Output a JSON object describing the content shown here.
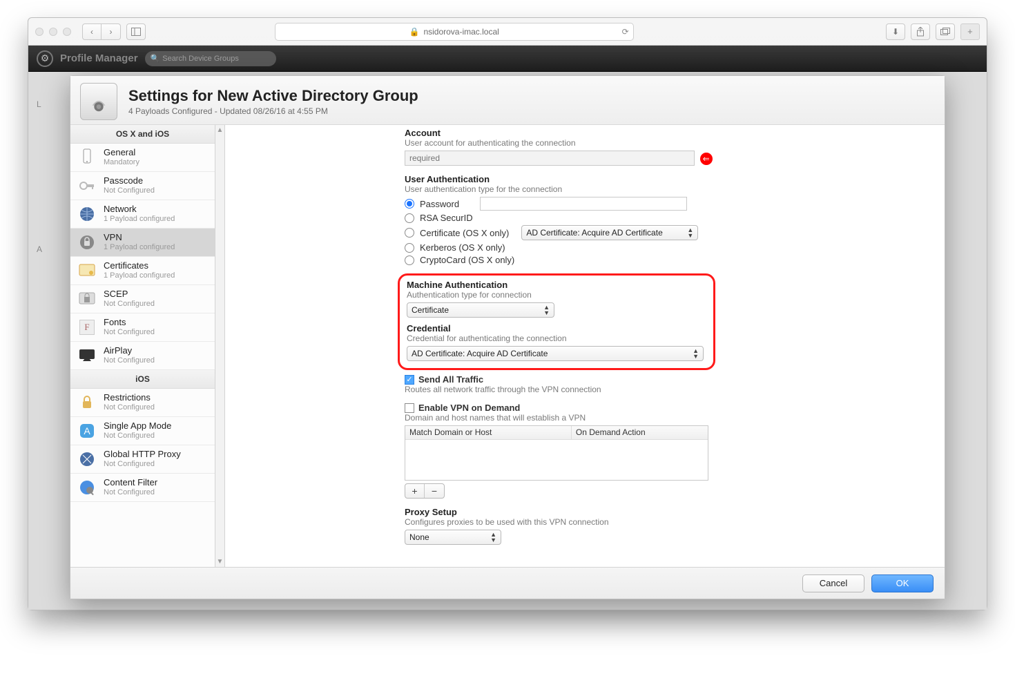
{
  "browser": {
    "address": "nsidorova-imac.local"
  },
  "app": {
    "title": "Profile Manager",
    "search_placeholder": "Search Device Groups"
  },
  "leftPanel": {
    "label_L": "L",
    "label_A": "A"
  },
  "modal": {
    "title": "Settings for New Active Directory Group",
    "subtitle": "4 Payloads Configured - Updated 08/26/16 at 4:55 PM",
    "group1": "OS X and iOS",
    "group2": "iOS",
    "payloads1": [
      {
        "title": "General",
        "status": "Mandatory"
      },
      {
        "title": "Passcode",
        "status": "Not Configured"
      },
      {
        "title": "Network",
        "status": "1 Payload configured"
      },
      {
        "title": "VPN",
        "status": "1 Payload configured"
      },
      {
        "title": "Certificates",
        "status": "1 Payload configured"
      },
      {
        "title": "SCEP",
        "status": "Not Configured"
      },
      {
        "title": "Fonts",
        "status": "Not Configured"
      },
      {
        "title": "AirPlay",
        "status": "Not Configured"
      }
    ],
    "payloads2": [
      {
        "title": "Restrictions",
        "status": "Not Configured"
      },
      {
        "title": "Single App Mode",
        "status": "Not Configured"
      },
      {
        "title": "Global HTTP Proxy",
        "status": "Not Configured"
      },
      {
        "title": "Content Filter",
        "status": "Not Configured"
      }
    ],
    "cancel": "Cancel",
    "ok": "OK"
  },
  "form": {
    "account": {
      "title": "Account",
      "desc": "User account for authenticating the connection",
      "placeholder": "required"
    },
    "user_auth": {
      "title": "User Authentication",
      "desc": "User authentication type for the connection",
      "opt_password": "Password",
      "opt_rsa": "RSA SecurID",
      "opt_cert": "Certificate (OS X only)",
      "opt_kerberos": "Kerberos (OS X only)",
      "opt_crypto": "CryptoCard (OS X only)",
      "cert_select": "AD Certificate: Acquire AD Certificate"
    },
    "machine_auth": {
      "title": "Machine Authentication",
      "desc": "Authentication type for connection",
      "select": "Certificate"
    },
    "credential": {
      "title": "Credential",
      "desc": "Credential for authenticating the connection",
      "select": "AD Certificate: Acquire AD Certificate"
    },
    "send_all": {
      "label": "Send All Traffic",
      "desc": "Routes all network traffic through the VPN connection"
    },
    "vpn_demand": {
      "label": "Enable VPN on Demand",
      "desc": "Domain and host names that will establish a VPN",
      "col1": "Match Domain or Host",
      "col2": "On Demand Action"
    },
    "proxy": {
      "title": "Proxy Setup",
      "desc": "Configures proxies to be used with this VPN connection",
      "select": "None"
    }
  }
}
